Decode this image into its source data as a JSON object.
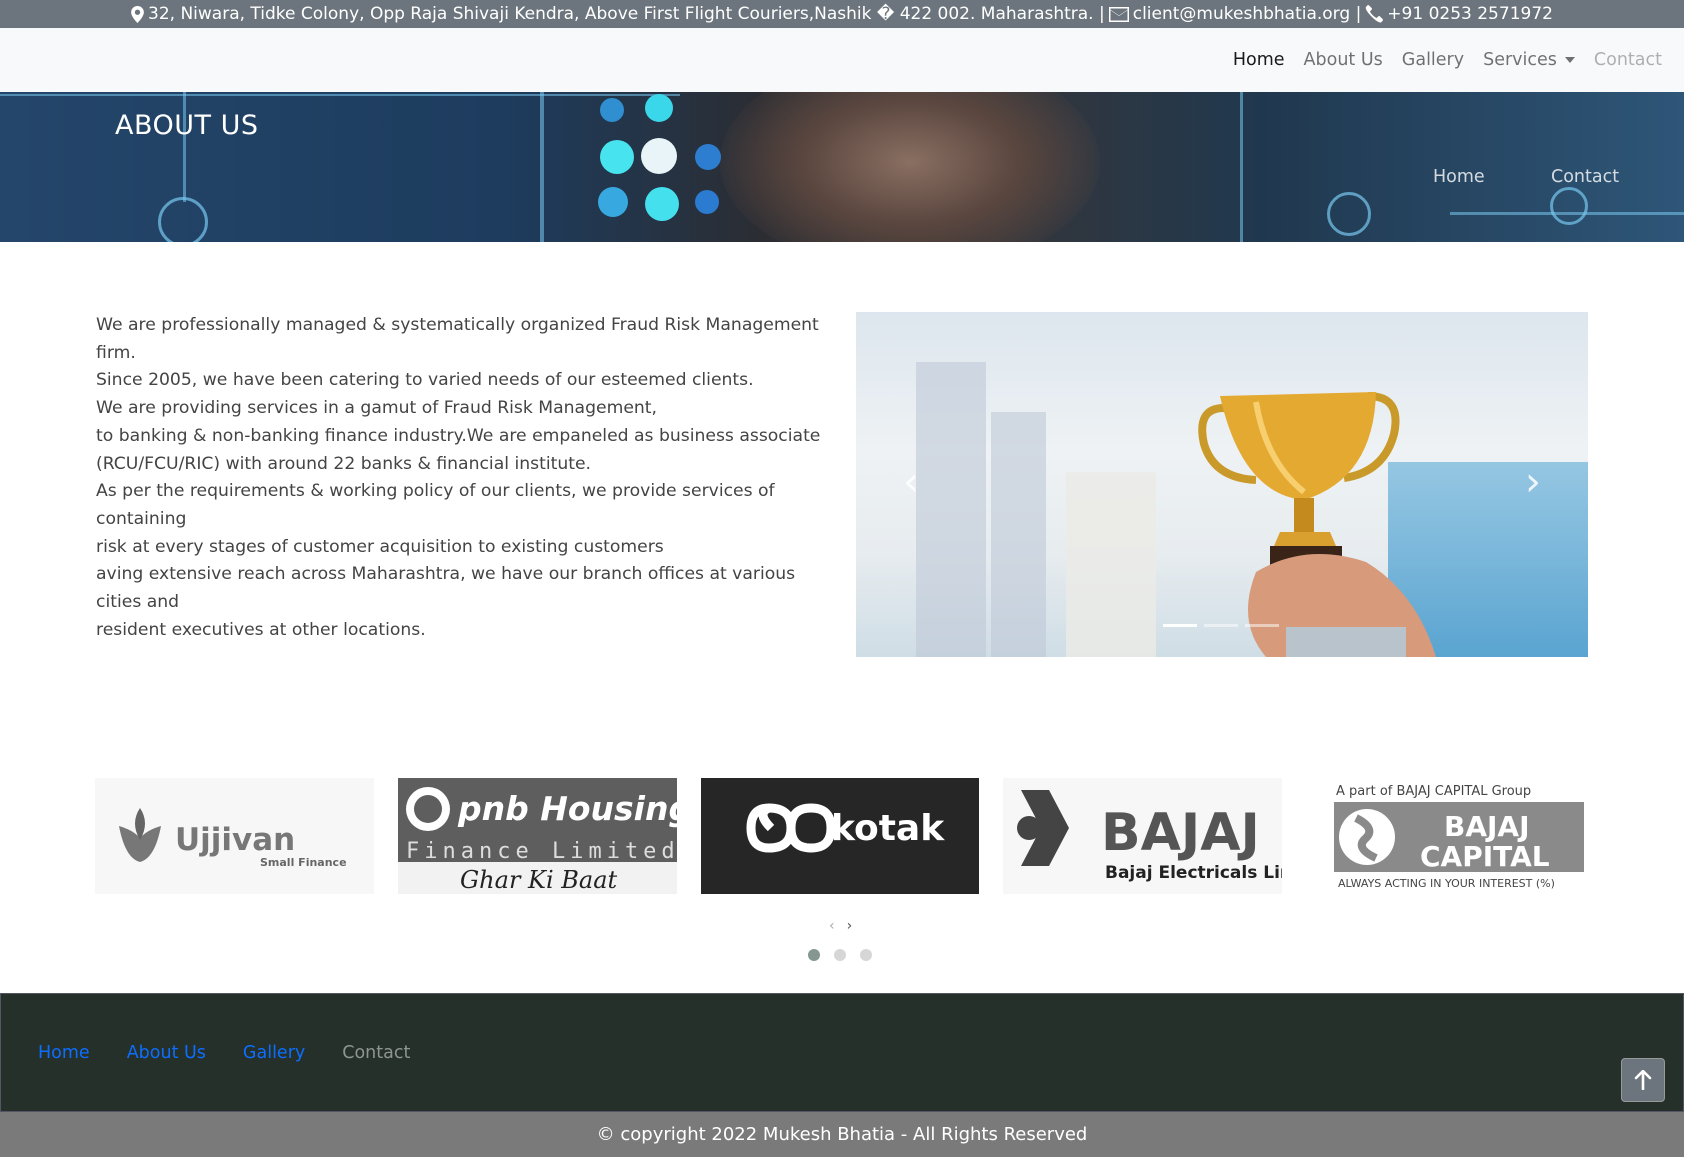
{
  "topbar": {
    "address": "32, Niwara, Tidke Colony, Opp Raja Shivaji Kendra, Above First Flight Couriers,Nashik � 422 002. Maharashtra. |",
    "email": "client@mukeshbhatia.org |",
    "phone": "+91 0253 2571972",
    "icons": [
      "map-marker-icon",
      "envelope-icon",
      "phone-icon"
    ]
  },
  "nav": {
    "items": [
      {
        "label": "Home"
      },
      {
        "label": "About Us"
      },
      {
        "label": "Gallery"
      },
      {
        "label": "Services"
      },
      {
        "label": "Contact"
      }
    ]
  },
  "banner": {
    "title": "ABOUT US",
    "breadcrumb": [
      "Home",
      "Contact"
    ]
  },
  "about": {
    "lines": [
      "We are professionally managed & systematically organized Fraud Risk Management firm.",
      "Since 2005, we have been catering to varied needs of our esteemed clients.",
      "We are providing services in a gamut of Fraud Risk Management,",
      "to banking & non-banking finance industry.We are empaneled as business associate",
      "(RCU/FCU/RIC) with around 22 banks & financial institute.",
      "As per the requirements & working policy of our clients, we provide services of containing",
      "risk at every stages of customer acquisition to existing customers",
      "aving extensive reach across Maharashtra, we have our branch offices at various cities and",
      "resident executives at other locations."
    ]
  },
  "carousel": {
    "prev": "‹",
    "next": "›",
    "indicator_count": 3,
    "active_indicator": 1
  },
  "partners": {
    "ujjivan": {
      "name": "Ujjivan",
      "sub": "Small Finance"
    },
    "pnb": {
      "name": "pnb Housing",
      "sub": "Finance Limited",
      "tag": "Ghar Ki Baat"
    },
    "kotak": {
      "name": "kotak"
    },
    "bajaj": {
      "name": "BAJAJ",
      "sub": "Bajaj Electricals Limited"
    },
    "bajajcap": {
      "top": "A part of BAJAJ CAPITAL Group",
      "name1": "BAJAJ",
      "name2": "CAPITAL",
      "tag": "ALWAYS ACTING IN YOUR INTEREST (%)"
    },
    "prev": "‹",
    "next": "›",
    "dot_count": 3,
    "active_dot": 1
  },
  "footer": {
    "links": [
      "Home",
      "About Us",
      "Gallery",
      "Contact"
    ],
    "copyright": "© copyright 2022 Mukesh Bhatia - All Rights Reserved"
  },
  "colors": {
    "topbar": "#6c757d",
    "footer": "#25302a",
    "link": "#0d6efd"
  }
}
